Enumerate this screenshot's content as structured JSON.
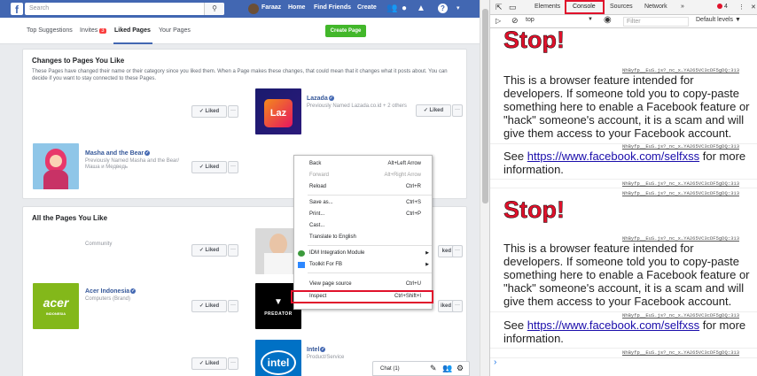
{
  "facebook": {
    "search_placeholder": "Search",
    "search_icon": "search-icon",
    "user_name": "Faraaz",
    "nav": [
      "Home",
      "Find Friends",
      "Create"
    ],
    "subtabs": [
      "Top Suggestions",
      "Invites",
      "Liked Pages",
      "Your Pages"
    ],
    "invites_badge": "3",
    "create_page": "Create Page",
    "changes_card": {
      "title": "Changes to Pages You Like",
      "desc": "These Pages have changed their name or their category since you liked them. When a Page makes these changes, that could mean that it changes what it posts about. You can decide if you want to stay connected to these Pages."
    },
    "lazada": {
      "logo": "Laz",
      "name": "Lazada",
      "previous": "Previously Named Lazada.co.id + 2 others",
      "liked_label": "Liked"
    },
    "masha": {
      "name": "Masha and the Bear",
      "previous": "Previously Named Masha and the Bear/",
      "previous2": "Маша и Медведь",
      "liked_label": "Liked"
    },
    "unnamed_liked_label": "Liked",
    "all_card": {
      "title": "All the Pages You Like"
    },
    "community": {
      "sub": "Community",
      "liked_label": "Liked"
    },
    "acer": {
      "logo": "acer",
      "logo_sub": "INDONESIA",
      "name": "Acer Indonesia",
      "sub": "Computers (Brand)",
      "liked_label": "Liked"
    },
    "predator": {
      "logo": "PREDATOR",
      "liked_label": "Liked"
    },
    "intel": {
      "logo": "intel",
      "name": "Intel",
      "sub": "Product/Service",
      "liked_label": "Liked"
    },
    "chat_label": "Chat (1)"
  },
  "context_menu": {
    "items": [
      {
        "label": "Back",
        "shortcut": "Alt+Left Arrow",
        "disabled": false
      },
      {
        "label": "Forward",
        "shortcut": "Alt+Right Arrow",
        "disabled": true
      },
      {
        "label": "Reload",
        "shortcut": "Ctrl+R",
        "disabled": false
      },
      {
        "label": "Save as...",
        "shortcut": "Ctrl+S",
        "disabled": false
      },
      {
        "label": "Print...",
        "shortcut": "Ctrl+P",
        "disabled": false
      },
      {
        "label": "Cast...",
        "shortcut": "",
        "disabled": false
      },
      {
        "label": "Translate to English",
        "shortcut": "",
        "disabled": false
      },
      {
        "label": "IDM Integration Module",
        "shortcut": "",
        "disabled": false
      },
      {
        "label": "Toolkit For FB",
        "shortcut": "",
        "disabled": false
      },
      {
        "label": "View page source",
        "shortcut": "Ctrl+U",
        "disabled": false
      },
      {
        "label": "Inspect",
        "shortcut": "Ctrl+Shift+I",
        "disabled": false
      }
    ]
  },
  "devtools": {
    "tabs": [
      "Elements",
      "Console",
      "Sources",
      "Network"
    ],
    "more_tabs": "»",
    "error_count": "4",
    "context": "top",
    "filter_placeholder": "Filter",
    "levels": "Default levels ▼",
    "stop_text": "Stop!",
    "warning_text": "This is a browser feature intended for developers. If someone told you to copy-paste something here to enable a Facebook feature or \"hack\" someone's account, it is a scam and will give them access to your Facebook account.",
    "see_prefix": "See ",
    "see_link": "https://www.facebook.com/selfxss",
    "see_suffix": " for more information.",
    "source": "NhByfp__EuS.js?_nc_x…YA265VC3cDF5gDQ:313",
    "prompt": "›"
  },
  "colors": {
    "fb_blue": "#4267b2",
    "highlight_red": "#e0112b",
    "stop_red": "#e0112b"
  }
}
